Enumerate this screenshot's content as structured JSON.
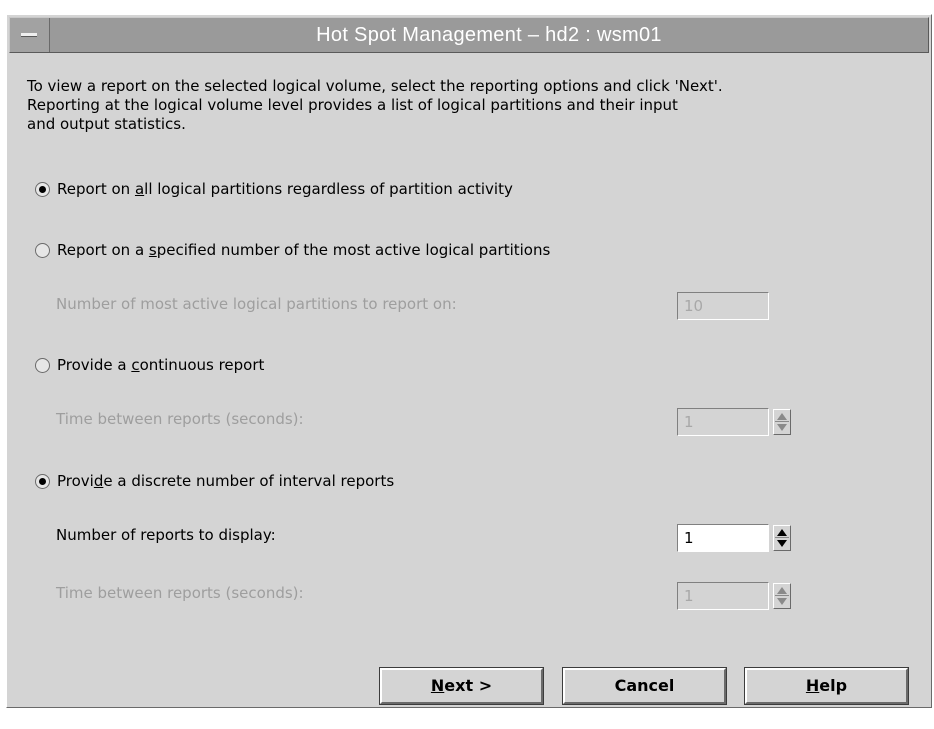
{
  "window": {
    "title": "Hot Spot Management – hd2 : wsm01"
  },
  "intro": {
    "line1": "To view a report on the selected logical volume, select the reporting options and click 'Next'.",
    "line2": "Reporting at the logical volume level provides a list of logical partitions and their input",
    "line3": "and output statistics."
  },
  "options": {
    "all_partitions": {
      "label_pre": "Report on ",
      "label_key": "a",
      "label_post": "ll logical partitions regardless of partition activity",
      "selected": true
    },
    "most_active": {
      "label_pre": "Report on a ",
      "label_key": "s",
      "label_post": "pecified number of the most active logical partitions",
      "selected": false,
      "field_label": "Number of most active logical partitions to report on:",
      "field_value": "10"
    },
    "continuous": {
      "label_pre": "Provide a ",
      "label_key": "c",
      "label_post": "ontinuous report",
      "selected": false,
      "field_label": "Time between reports (seconds):",
      "field_value": "1"
    },
    "discrete": {
      "label_pre": "Provi",
      "label_key": "d",
      "label_post": "e a discrete number of interval reports",
      "selected": true,
      "count_label": "Number of reports to display:",
      "count_value": "1",
      "interval_label": "Time between reports (seconds):",
      "interval_value": "1"
    }
  },
  "buttons": {
    "next_key": "N",
    "next_rest": "ext >",
    "cancel": "Cancel",
    "help_key": "H",
    "help_rest": "elp"
  }
}
